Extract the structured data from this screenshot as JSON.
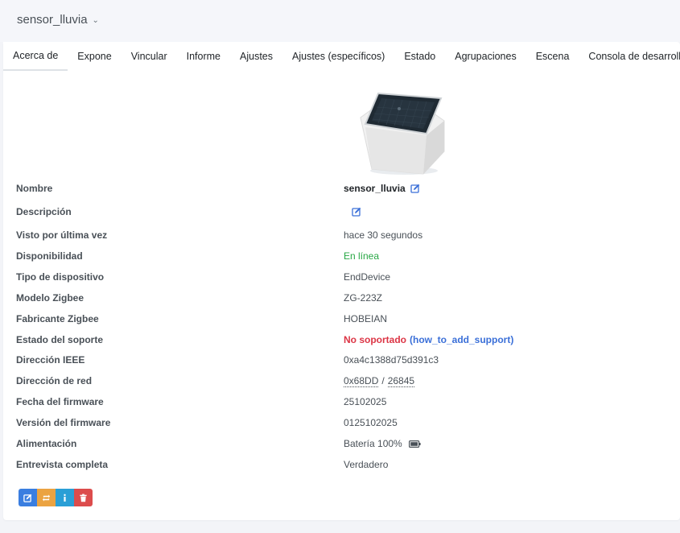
{
  "header": {
    "device_name": "sensor_lluvia"
  },
  "tabs": [
    "Acerca de",
    "Expone",
    "Vincular",
    "Informe",
    "Ajustes",
    "Ajustes (específicos)",
    "Estado",
    "Agrupaciones",
    "Escena",
    "Consola de desarrollo"
  ],
  "active_tab": "Acerca de",
  "about": {
    "name_label": "Nombre",
    "name_value": "sensor_lluvia",
    "description_label": "Descripción",
    "last_seen_label": "Visto por última vez",
    "last_seen_value": "hace 30 segundos",
    "availability_label": "Disponibilidad",
    "availability_value": "En línea",
    "device_type_label": "Tipo de dispositivo",
    "device_type_value": "EndDevice",
    "zigbee_model_label": "Modelo Zigbee",
    "zigbee_model_value": "ZG-223Z",
    "zigbee_manufacturer_label": "Fabricante Zigbee",
    "zigbee_manufacturer_value": "HOBEIAN",
    "support_status_label": "Estado del soporte",
    "support_status_value": "No soportado",
    "support_link_open": "(",
    "support_link": "how_to_add_support",
    "support_link_close": ")",
    "ieee_label": "Dirección IEEE",
    "ieee_value": "0xa4c1388d75d391c3",
    "network_label": "Dirección de red",
    "network_hex": "0x68DD",
    "network_separator": "/",
    "network_dec": "26845",
    "firmware_date_label": "Fecha del firmware",
    "firmware_date_value": "25102025",
    "firmware_version_label": "Versión del firmware",
    "firmware_version_value": "0125102025",
    "power_label": "Alimentación",
    "power_value": "Batería 100%",
    "interview_label": "Entrevista completa",
    "interview_value": "Verdadero"
  },
  "colors": {
    "online": "#28a745",
    "unsupported": "#dc3545",
    "link": "#3a6fd8"
  },
  "icons": {
    "title_dropdown": "chevron-down-icon",
    "edit": "edit-icon",
    "battery": "battery-icon",
    "rename": "edit-icon",
    "reconfigure": "refresh-icon",
    "interview": "info-icon",
    "remove": "trash-icon"
  }
}
